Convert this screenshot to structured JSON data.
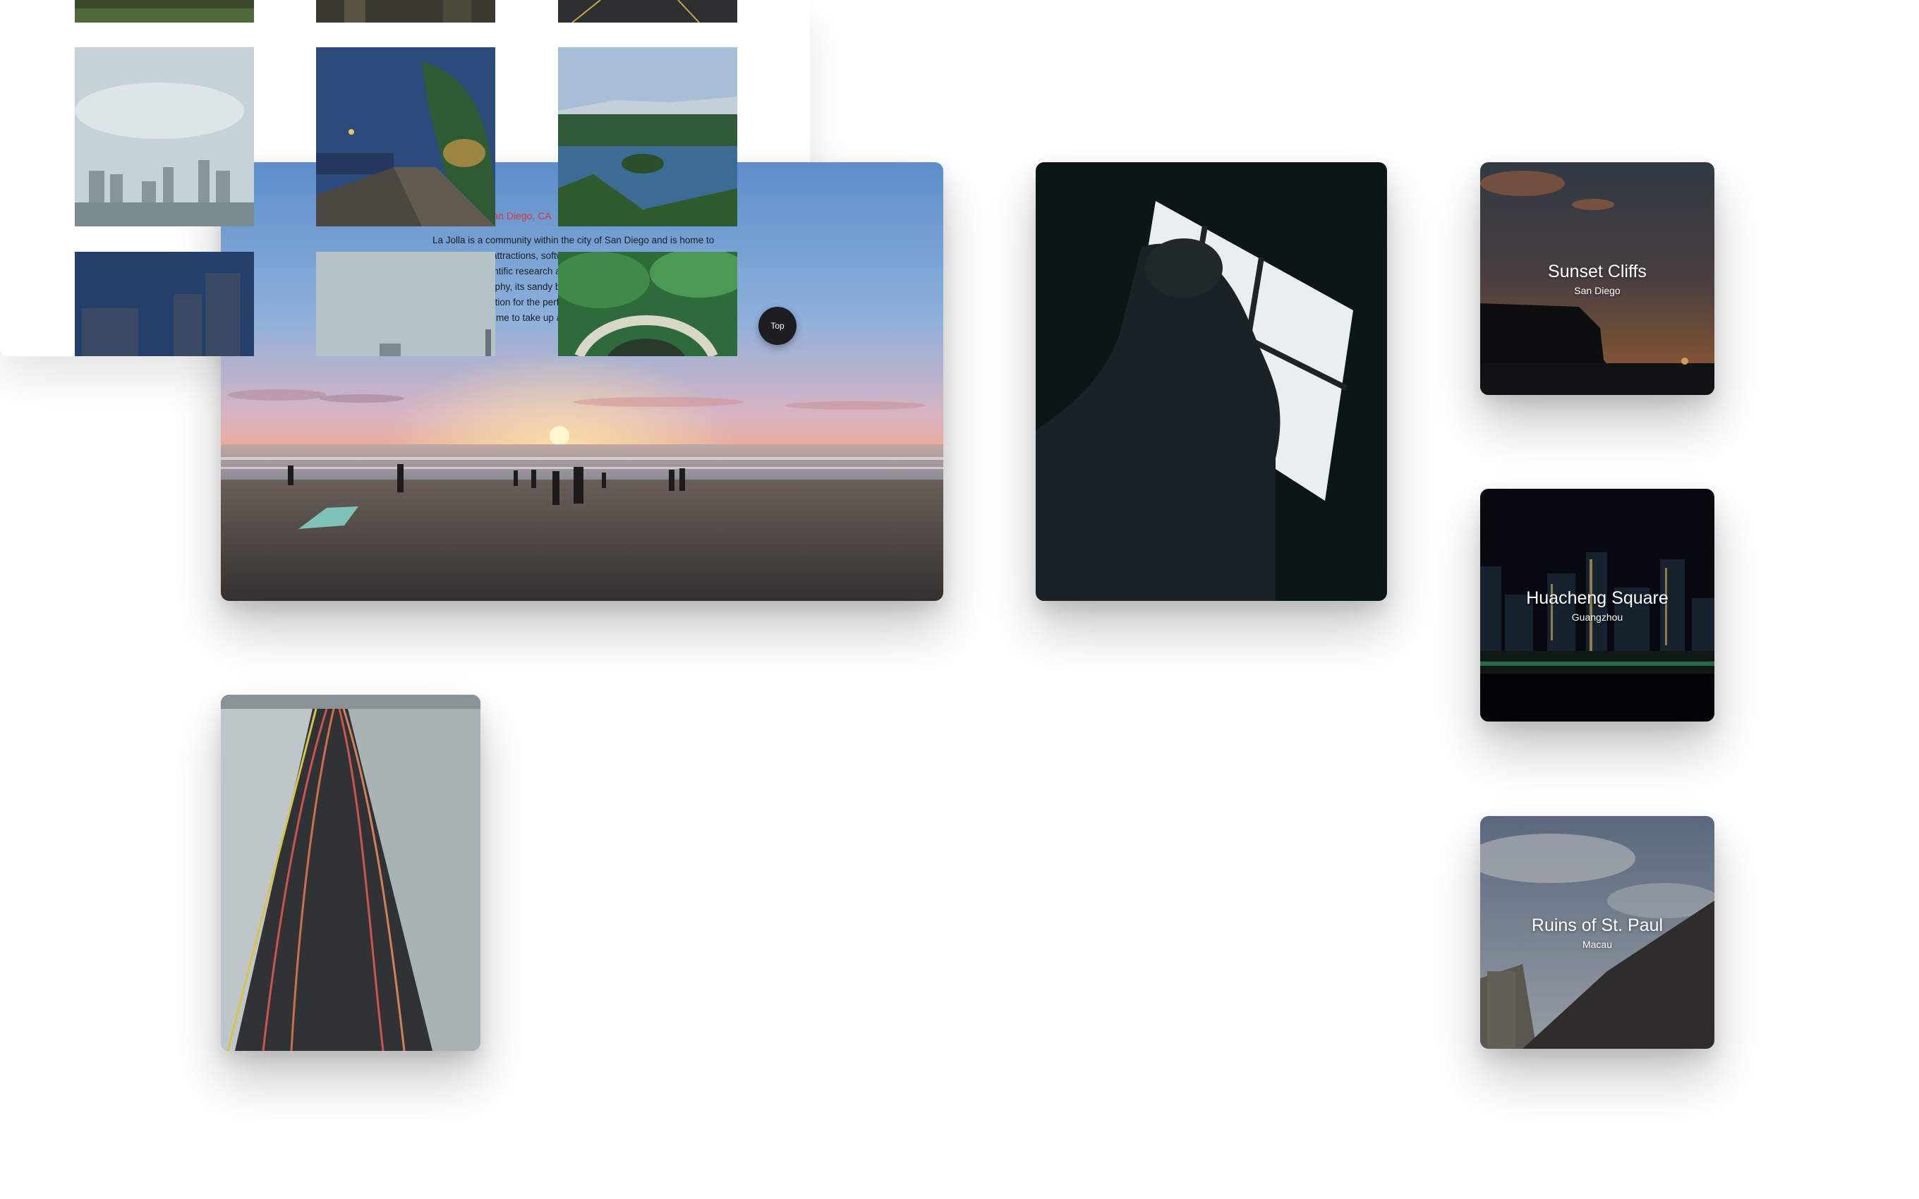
{
  "hero": {
    "location": "La Jolla, San Diego, CA",
    "description": "La Jolla is a community within the city of San Diego and is home to many cultural attractions, software and bioengineering companies, and leaders in scientific research and education. Because of La Jolla's coastal geography, its sandy beaches and rugged shorelines make it the top destination for the perfect sunset photo. Traveling around San Diego inspired me to take up a camera and begin image collecting in general."
  },
  "locations": [
    {
      "title": "Sunset Cliffs",
      "subtitle": "San Diego"
    },
    {
      "title": "Huacheng Square",
      "subtitle": "Guangzhou"
    },
    {
      "title": "Ruins of St. Paul",
      "subtitle": "Macau"
    }
  ],
  "gallery": {
    "top_button": "Top"
  },
  "colors": {
    "accent": "#d9363e",
    "top_button_bg": "#1e1e22"
  }
}
